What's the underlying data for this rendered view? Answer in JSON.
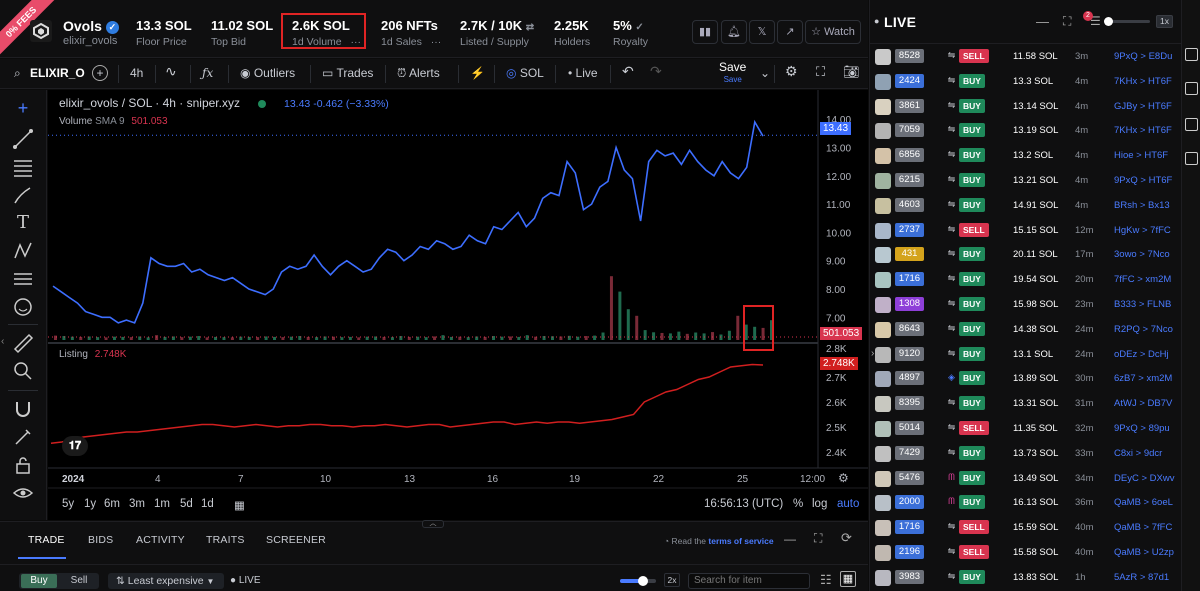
{
  "badge": {
    "ribbon": "0% FEES"
  },
  "collection": {
    "name": "Ovols",
    "handle": "elixir_ovols"
  },
  "stats": [
    {
      "value": "13.3 SOL",
      "label": "Floor Price"
    },
    {
      "value": "11.02 SOL",
      "label": "Top Bid"
    },
    {
      "value": "2.6K SOL",
      "label": "1d Volume",
      "menu": "···"
    },
    {
      "value": "206 NFTs",
      "label": "1d Sales",
      "menu": "···"
    },
    {
      "value": "2.7K / 10K",
      "label": "Listed / Supply",
      "menu": "⇄"
    },
    {
      "value": "2.25K",
      "label": "Holders"
    },
    {
      "value": "5%",
      "label": "Royalty",
      "menu": "✓"
    }
  ],
  "header_actions": {
    "watch_label": "Watch",
    "x_label": "𝕏"
  },
  "toolbar": {
    "symbol": "ELIXIR_O",
    "interval": "4h",
    "outliers": "Outliers",
    "trades": "Trades",
    "alerts": "Alerts",
    "currency": "SOL",
    "live": "Live",
    "save": "Save",
    "save_sub": "Save"
  },
  "chart": {
    "title": "elixir_ovols / SOL · 4h · sniper.xyz",
    "ohlc": "13.43  -0.462 (−3.33%)",
    "volume_label": "Volume",
    "volume_sma": "SMA 9",
    "volume_value": "501.053",
    "listing_label": "Listing",
    "listing_value": "2.748K",
    "current_price_label": "13.43",
    "volume_price_label": "501.053",
    "listing_price_label": "2.748K",
    "listing_axis_top": "2.8K"
  },
  "chart_data": {
    "type": "line",
    "price_axis": {
      "ticks": [
        "14.00",
        "13.00",
        "12.00",
        "11.00",
        "10.00",
        "9.00",
        "8.00",
        "7.00"
      ],
      "ylim": [
        6.55,
        14.5
      ]
    },
    "listing_axis": {
      "ticks": [
        "2.8K",
        "2.7K",
        "2.6K",
        "2.5K",
        "2.4K"
      ],
      "ylim": [
        2.36,
        2.8
      ]
    },
    "x_ticks": [
      "2024",
      "4",
      "7",
      "10",
      "13",
      "16",
      "19",
      "22",
      "25",
      "12:00"
    ],
    "series": [
      {
        "name": "elixir_ovols / SOL",
        "color": "#3d6eff",
        "values": [
          8.1,
          7.9,
          7.7,
          7.5,
          7.2,
          7.1,
          7.0,
          7.0,
          6.8,
          6.9,
          6.8,
          7.5,
          9.1,
          8.9,
          8.8,
          8.8,
          8.9,
          8.6,
          8.7,
          8.5,
          8.4,
          8.3,
          8.4,
          8.2,
          8.0,
          7.9,
          7.8,
          8.0,
          8.6,
          8.8,
          8.7,
          8.8,
          9.2,
          8.8,
          8.5,
          8.8,
          9.0,
          8.8,
          8.6,
          8.7,
          9.1,
          9.4,
          9.3,
          9.0,
          9.2,
          9.5,
          9.4,
          9.7,
          9.6,
          9.4,
          9.5,
          9.9,
          9.7,
          9.6,
          10.2,
          10.1,
          10.4,
          10.7,
          10.2,
          10.5,
          11.2,
          11.4,
          11.3,
          12.5,
          12.1,
          10.8,
          11.0,
          11.6,
          11.8,
          13.0,
          12.2,
          11.9,
          10.4,
          12.5,
          12.9,
          12.7,
          12.8,
          12.4,
          12.9,
          12.5,
          12.2,
          12.0,
          12.5,
          12.1,
          11.9,
          12.3,
          13.9,
          13.4
        ]
      },
      {
        "name": "Volume",
        "values": [
          20,
          18,
          15,
          14,
          16,
          13,
          12,
          15,
          14,
          13,
          16,
          12,
          22,
          14,
          16,
          13,
          15,
          18,
          12,
          14,
          13,
          12,
          15,
          14,
          13,
          16,
          14,
          13,
          15,
          18,
          14,
          13,
          16,
          15,
          13,
          14,
          12,
          15,
          16,
          14,
          13,
          18,
          14,
          15,
          13,
          16,
          22,
          14,
          15,
          13,
          16,
          14,
          18,
          15,
          16,
          14,
          22,
          15,
          18,
          17,
          16,
          19,
          15,
          18,
          20,
          34,
          290,
          220,
          140,
          110,
          45,
          35,
          32,
          30,
          38,
          28,
          34,
          30,
          36,
          25,
          42,
          110,
          70,
          60,
          55,
          90
        ]
      },
      {
        "name": "Listing",
        "color": "#d11f1f",
        "values": [
          2.435,
          2.44,
          2.45,
          2.46,
          2.465,
          2.47,
          2.475,
          2.48,
          2.48,
          2.485,
          2.49,
          2.495,
          2.5,
          2.505,
          2.51,
          2.51,
          2.505,
          2.5,
          2.505,
          2.51,
          2.505,
          2.5,
          2.505,
          2.505,
          2.51,
          2.51,
          2.505,
          2.505,
          2.5,
          2.505,
          2.505,
          2.51,
          2.505,
          2.5,
          2.505,
          2.51,
          2.51,
          2.5,
          2.505,
          2.51,
          2.515,
          2.52,
          2.52,
          2.51,
          2.515,
          2.52,
          2.515,
          2.52,
          2.52,
          2.515,
          2.52,
          2.525,
          2.53,
          2.54,
          2.55,
          2.6,
          2.62,
          2.64,
          2.65,
          2.67,
          2.69,
          2.7,
          2.72,
          2.74,
          2.745,
          2.75,
          2.748
        ]
      }
    ]
  },
  "range_bar": {
    "ranges": [
      "5y",
      "1y",
      "6m",
      "3m",
      "1m",
      "5d",
      "1d"
    ],
    "clock": "16:56:13 (UTC)",
    "percent": "%",
    "log": "log",
    "auto": "auto"
  },
  "bottom": {
    "tabs": [
      "TRADE",
      "BIDS",
      "ACTIVITY",
      "TRAITS",
      "SCREENER"
    ],
    "terms_prefix": "Read the",
    "terms_link": "terms of service",
    "buy": "Buy",
    "sell": "Sell",
    "sort": "Least expensive",
    "live": "LIVE",
    "zoom": "2x",
    "search_placeholder": "Search for item"
  },
  "live_panel": {
    "title": "LIVE",
    "notif_count": "2",
    "speed": "1x",
    "rows": [
      {
        "rank": "8528",
        "rank_color": "#6b6f78",
        "action": "SELL",
        "price": "11.58 SOL",
        "time": "3m",
        "trade": "9PxQ > E8Du",
        "src": "bolt"
      },
      {
        "rank": "2424",
        "rank_color": "#3b6fd8",
        "action": "BUY",
        "price": "13.3 SOL",
        "time": "4m",
        "trade": "7KHx > HT6F",
        "src": "bolt"
      },
      {
        "rank": "3861",
        "rank_color": "#6b6f78",
        "action": "BUY",
        "price": "13.14 SOL",
        "time": "4m",
        "trade": "GJBy > HT6F",
        "src": "bolt"
      },
      {
        "rank": "7059",
        "rank_color": "#6b6f78",
        "action": "BUY",
        "price": "13.19 SOL",
        "time": "4m",
        "trade": "7KHx > HT6F",
        "src": "bolt"
      },
      {
        "rank": "6856",
        "rank_color": "#6b6f78",
        "action": "BUY",
        "price": "13.2 SOL",
        "time": "4m",
        "trade": "Hioe > HT6F",
        "src": "bolt"
      },
      {
        "rank": "6215",
        "rank_color": "#6b6f78",
        "action": "BUY",
        "price": "13.21 SOL",
        "time": "4m",
        "trade": "9PxQ > HT6F",
        "src": "bolt"
      },
      {
        "rank": "4603",
        "rank_color": "#6b6f78",
        "action": "BUY",
        "price": "14.91 SOL",
        "time": "4m",
        "trade": "BRsh > Bx13",
        "src": "bolt"
      },
      {
        "rank": "2737",
        "rank_color": "#3b6fd8",
        "action": "SELL",
        "price": "15.15 SOL",
        "time": "12m",
        "trade": "HgKw > 7fFC",
        "src": "bolt"
      },
      {
        "rank": "431",
        "rank_color": "#d4a31c",
        "action": "BUY",
        "price": "20.11 SOL",
        "time": "17m",
        "trade": "3owo > 7Nco",
        "src": "bolt"
      },
      {
        "rank": "1716",
        "rank_color": "#3b6fd8",
        "action": "BUY",
        "price": "19.54 SOL",
        "time": "20m",
        "trade": "7fFC > xm2M",
        "src": "bolt"
      },
      {
        "rank": "1308",
        "rank_color": "#8e3fd8",
        "action": "BUY",
        "price": "15.98 SOL",
        "time": "23m",
        "trade": "B333 > FLNB",
        "src": "bolt"
      },
      {
        "rank": "8643",
        "rank_color": "#6b6f78",
        "action": "BUY",
        "price": "14.38 SOL",
        "time": "24m",
        "trade": "R2PQ > 7Nco",
        "src": "bolt"
      },
      {
        "rank": "9120",
        "rank_color": "#6b6f78",
        "action": "BUY",
        "price": "13.1 SOL",
        "time": "24m",
        "trade": "oDEz > DcHj",
        "src": "bolt"
      },
      {
        "rank": "4897",
        "rank_color": "#6b6f78",
        "action": "BUY",
        "price": "13.89 SOL",
        "time": "30m",
        "trade": "6zB7 > xm2M",
        "src": "tensor"
      },
      {
        "rank": "8395",
        "rank_color": "#6b6f78",
        "action": "BUY",
        "price": "13.31 SOL",
        "time": "31m",
        "trade": "AtWJ > DB7V",
        "src": "bolt"
      },
      {
        "rank": "5014",
        "rank_color": "#6b6f78",
        "action": "SELL",
        "price": "11.35 SOL",
        "time": "32m",
        "trade": "9PxQ > 89pu",
        "src": "bolt"
      },
      {
        "rank": "7429",
        "rank_color": "#6b6f78",
        "action": "BUY",
        "price": "13.73 SOL",
        "time": "33m",
        "trade": "C8xi > 9dcr",
        "src": "bolt"
      },
      {
        "rank": "5476",
        "rank_color": "#6b6f78",
        "action": "BUY",
        "price": "13.49 SOL",
        "time": "34m",
        "trade": "DEyC > DXwv",
        "src": "me"
      },
      {
        "rank": "2000",
        "rank_color": "#3b6fd8",
        "action": "BUY",
        "price": "16.13 SOL",
        "time": "36m",
        "trade": "QaMB > 6oeL",
        "src": "me"
      },
      {
        "rank": "1716",
        "rank_color": "#3b6fd8",
        "action": "SELL",
        "price": "15.59 SOL",
        "time": "40m",
        "trade": "QaMB > 7fFC",
        "src": "bolt"
      },
      {
        "rank": "2196",
        "rank_color": "#3b6fd8",
        "action": "SELL",
        "price": "15.58 SOL",
        "time": "40m",
        "trade": "QaMB > U2zp",
        "src": "bolt"
      },
      {
        "rank": "3983",
        "rank_color": "#6b6f78",
        "action": "BUY",
        "price": "13.83 SOL",
        "time": "1h",
        "trade": "5AzR > 87d1",
        "src": "bolt"
      }
    ]
  },
  "colors": {
    "buy": "#1f8a5b",
    "sell": "#d8344f",
    "accent": "#4a7bff",
    "price_line": "#3d6eff",
    "listing_line": "#d11f1f",
    "highlight_box": "#e02424"
  }
}
